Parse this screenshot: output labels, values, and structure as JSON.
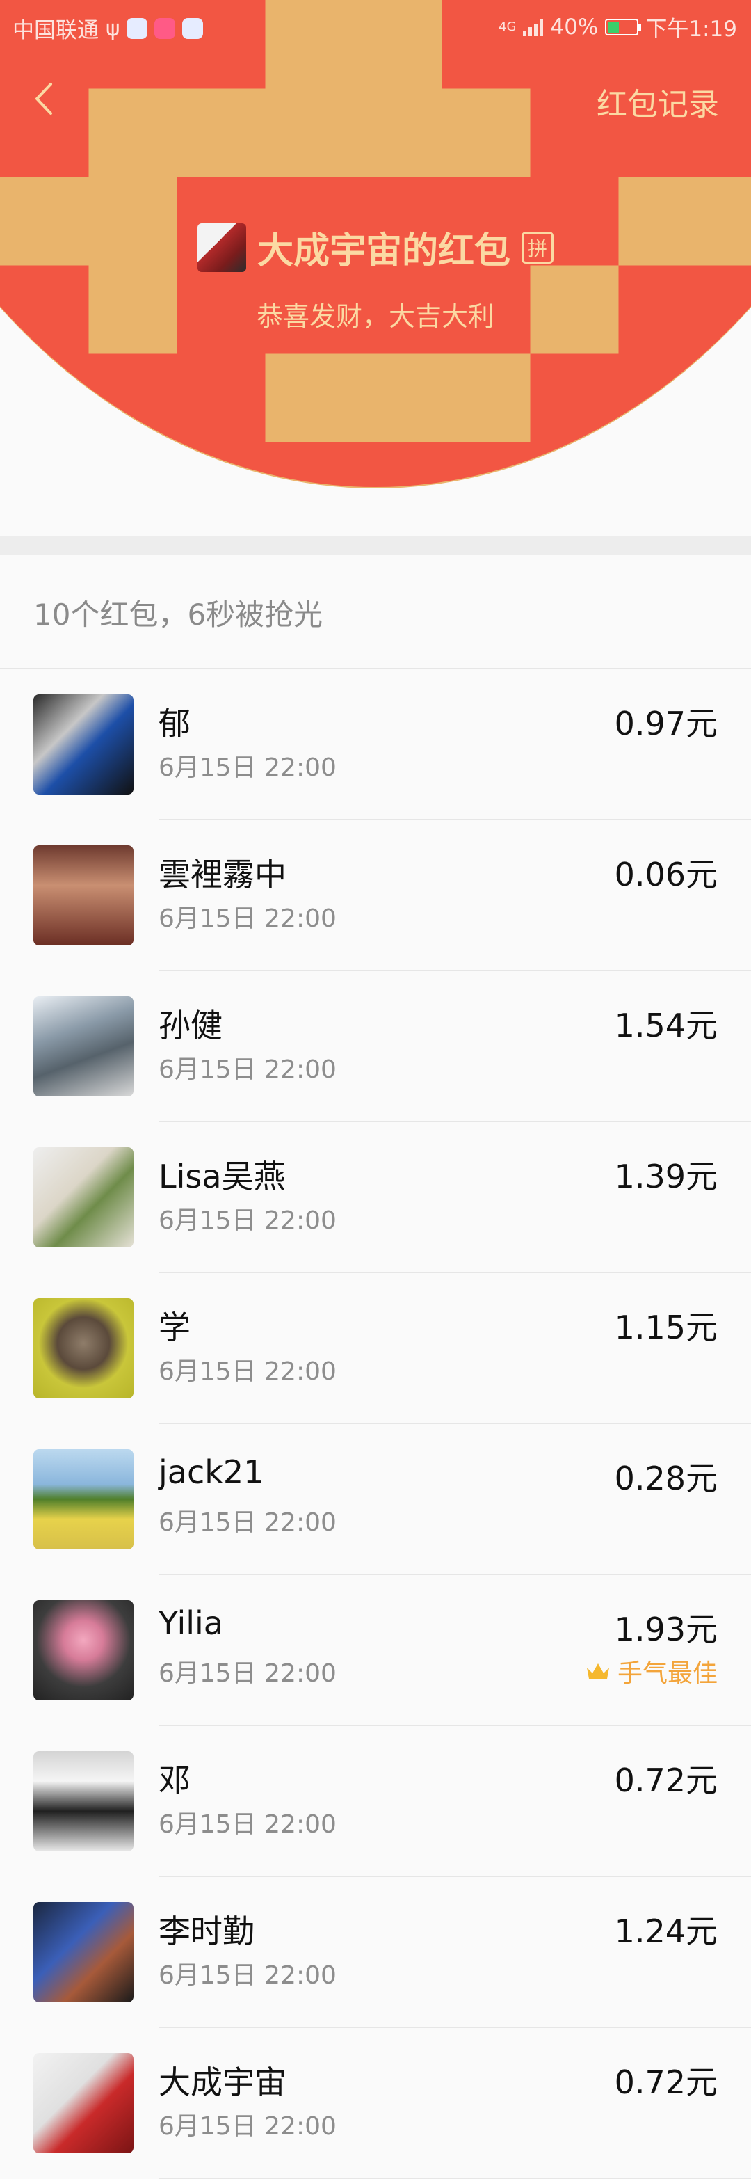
{
  "status_bar": {
    "carrier": "中国联通",
    "network": "4G",
    "battery": "40%",
    "battery_level": 0.4,
    "time": "下午1:19",
    "colors": {
      "battery_fill": "#3bd06a"
    }
  },
  "header": {
    "back_icon": "chevron-left-icon",
    "record_label": "红包记录",
    "sender_name": "大成宇宙的红包",
    "pin_label": "拼",
    "blessing": "恭喜发财，大吉大利",
    "colors": {
      "background": "#f25643",
      "accent": "#fbd9a3"
    }
  },
  "summary": "10个红包，6秒被抢光",
  "list": [
    {
      "name": "郁",
      "time": "6月15日  22:00",
      "amount": "0.97元"
    },
    {
      "name": "雲裡霧中",
      "time": "6月15日  22:00",
      "amount": "0.06元"
    },
    {
      "name": "孙健",
      "time": "6月15日  22:00",
      "amount": "1.54元"
    },
    {
      "name": "Lisa吴燕",
      "time": "6月15日  22:00",
      "amount": "1.39元"
    },
    {
      "name": "学",
      "time": "6月15日  22:00",
      "amount": "1.15元"
    },
    {
      "name": "jack21",
      "time": "6月15日  22:00",
      "amount": "0.28元"
    },
    {
      "name": "Yilia",
      "time": "6月15日  22:00",
      "amount": "1.93元",
      "best_label": "手气最佳"
    },
    {
      "name": "邓",
      "time": "6月15日  22:00",
      "amount": "0.72元"
    },
    {
      "name": "李时勤",
      "time": "6月15日  22:00",
      "amount": "1.24元"
    },
    {
      "name": "大成宇宙",
      "time": "6月15日  22:00",
      "amount": "0.72元"
    }
  ],
  "colors": {
    "best_label": "#f3a43a"
  }
}
